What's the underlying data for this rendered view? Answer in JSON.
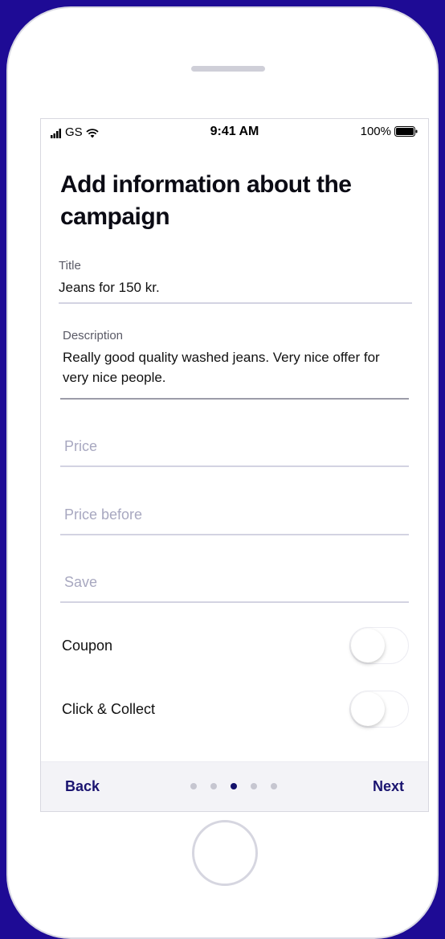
{
  "status_bar": {
    "carrier": "GS",
    "time": "9:41 AM",
    "battery": "100%"
  },
  "page": {
    "title": "Add information about the campaign"
  },
  "form": {
    "title": {
      "label": "Title",
      "value": "Jeans for 150 kr."
    },
    "description": {
      "label": "Description",
      "value": "Really good quality washed jeans. Very nice offer for very nice people."
    },
    "price": {
      "placeholder": "Price"
    },
    "price_before": {
      "placeholder": "Price before"
    },
    "save": {
      "placeholder": "Save"
    },
    "coupon": {
      "label": "Coupon",
      "enabled": false
    },
    "click_collect": {
      "label": "Click & Collect",
      "enabled": false
    }
  },
  "footer": {
    "back_label": "Back",
    "next_label": "Next",
    "pages_total": 5,
    "current_page": 3
  },
  "colors": {
    "background": "#1e0b95",
    "accent": "#1a1470"
  }
}
